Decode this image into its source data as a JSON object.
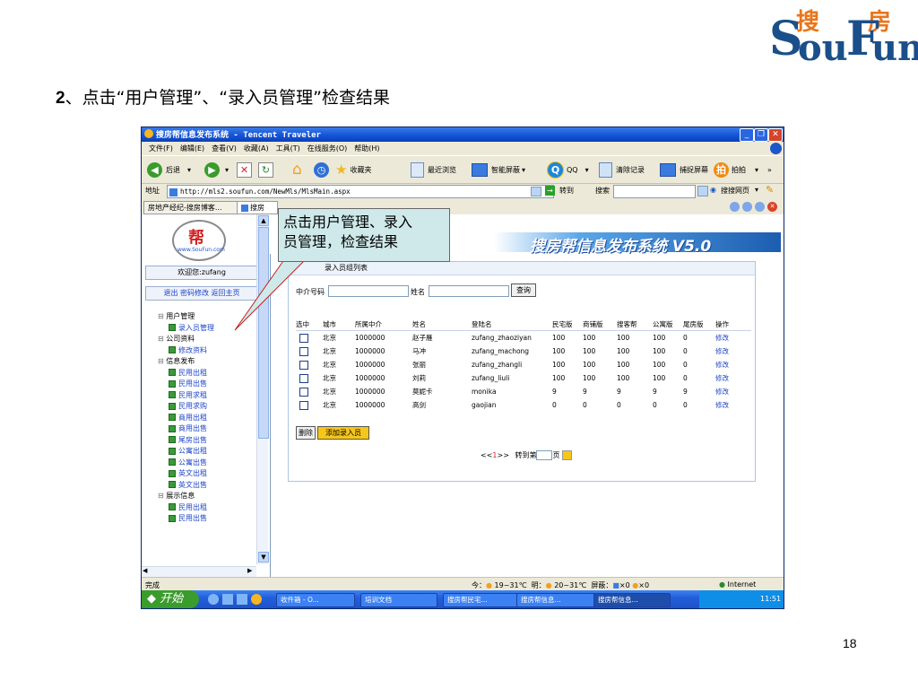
{
  "logo": {
    "cn": [
      "搜",
      "房"
    ],
    "en_s": "S",
    "en_ou": "ou",
    "en_f": "F",
    "en_un": "un"
  },
  "slide": {
    "title_num": "2",
    "title_rest": "、点击“用户管理”、“录入员管理”检查结果",
    "page_number": "18"
  },
  "callout": {
    "line1": "点击用户管理、录入",
    "line2": "员管理，检查结果"
  },
  "window": {
    "title": "搜房帮信息发布系统 - Tencent Traveler",
    "menu": [
      "文件(F)",
      "编辑(E)",
      "查看(V)",
      "收藏(A)",
      "工具(T)",
      "在线服务(O)",
      "帮助(H)"
    ],
    "toolbar": {
      "back": "后退",
      "favorites": "收藏夹",
      "recent": "最近浏览",
      "smart_screen": "智能屏蔽",
      "qq": "QQ",
      "clear": "清除记录",
      "capture": "捕捉屏幕",
      "paipai": "拍拍"
    },
    "address": {
      "label": "地址",
      "url": "http://mls2.soufun.com/NewMls/MlsMain.aspx",
      "go": "转到",
      "search_label": "搜索",
      "search_btn": "搜搜网页"
    },
    "tabs": [
      "房地产经纪-搜房博客...",
      "搜房"
    ],
    "status": {
      "done": "完成",
      "weather_today": "今：",
      "temp_today": "19~31℃",
      "weather_tomorrow": "明：",
      "temp_tomorrow": "20~31℃",
      "block_label": "屏蔽：",
      "block1": "×0",
      "block2": "×0",
      "zone": "Internet"
    }
  },
  "leftframe": {
    "logo_char": "帮",
    "logo_ring": "www.SouFun.com",
    "welcome": "欢迎您:zufang",
    "links": [
      "退出",
      "密码修改",
      "返回主页"
    ],
    "tree": [
      {
        "label": "用户管理",
        "level": 0
      },
      {
        "label": "录入员管理",
        "level": 1
      },
      {
        "label": "公司资料",
        "level": 0
      },
      {
        "label": "修改资料",
        "level": 1
      },
      {
        "label": "信息发布",
        "level": 0
      },
      {
        "label": "民用出租",
        "level": 1
      },
      {
        "label": "民用出售",
        "level": 1
      },
      {
        "label": "民用求租",
        "level": 1
      },
      {
        "label": "民用求购",
        "level": 1
      },
      {
        "label": "商用出租",
        "level": 1
      },
      {
        "label": "商用出售",
        "level": 1
      },
      {
        "label": "尾房出售",
        "level": 1
      },
      {
        "label": "公寓出租",
        "level": 1
      },
      {
        "label": "公寓出售",
        "level": 1
      },
      {
        "label": "英文出租",
        "level": 1
      },
      {
        "label": "英文出售",
        "level": 1
      },
      {
        "label": "展示信息",
        "level": 0
      },
      {
        "label": "民用出租",
        "level": 1
      },
      {
        "label": "民用出售",
        "level": 1
      }
    ]
  },
  "main": {
    "banner": "搜房帮信息发布系统 V5.0",
    "panel_title": "录入员组列表",
    "agent_no_label": "中介号码",
    "name_label": "姓名",
    "search_btn": "查询",
    "columns": [
      "选中",
      "城市",
      "所属中介",
      "姓名",
      "登陆名",
      "民宅版",
      "商铺版",
      "搜客帮",
      "公寓版",
      "尾房版",
      "操作"
    ],
    "rows": [
      [
        "北京",
        "1000000",
        "赵子雁",
        "zufang_zhaoziyan",
        "100",
        "100",
        "100",
        "100",
        "0",
        "修改"
      ],
      [
        "北京",
        "1000000",
        "马冲",
        "zufang_machong",
        "100",
        "100",
        "100",
        "100",
        "0",
        "修改"
      ],
      [
        "北京",
        "1000000",
        "张丽",
        "zufang_zhangli",
        "100",
        "100",
        "100",
        "100",
        "0",
        "修改"
      ],
      [
        "北京",
        "1000000",
        "刘莉",
        "zufang_liuli",
        "100",
        "100",
        "100",
        "100",
        "0",
        "修改"
      ],
      [
        "北京",
        "1000000",
        "莫妮卡",
        "monika",
        "9",
        "9",
        "9",
        "9",
        "9",
        "修改"
      ],
      [
        "北京",
        "1000000",
        "高剑",
        "gaojian",
        "0",
        "0",
        "0",
        "0",
        "0",
        "修改"
      ]
    ],
    "delete_btn": "删除",
    "add_btn": "添加录入员",
    "pager_prev": "<<",
    "pager_page": "1",
    "pager_next": ">>",
    "pager_goto": "转到第",
    "pager_unit": "页"
  },
  "taskbar": {
    "start": "开始",
    "tasks": [
      "收件箱 - O...",
      "培训文档",
      "搜房帮民宅...",
      "搜房帮信息...",
      "搜房帮信息..."
    ],
    "clock": "11:51"
  }
}
